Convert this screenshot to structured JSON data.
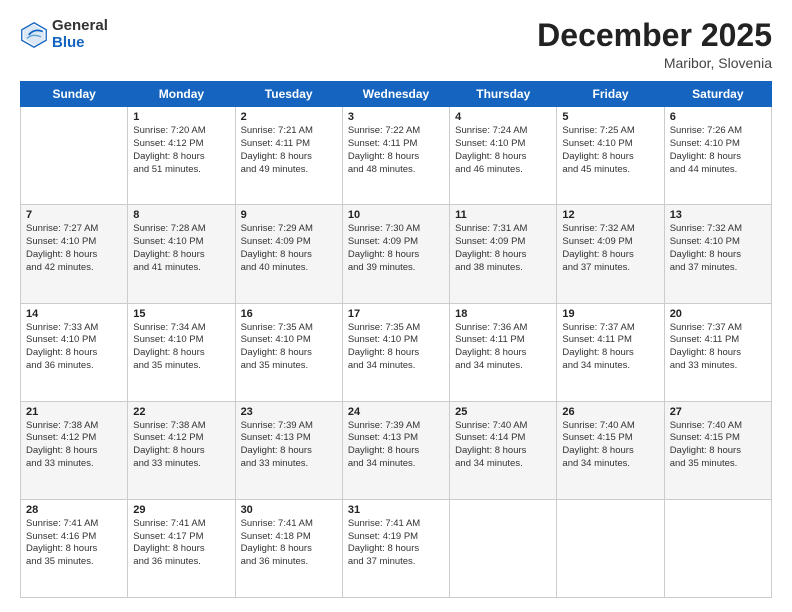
{
  "logo": {
    "general": "General",
    "blue": "Blue"
  },
  "header": {
    "month": "December 2025",
    "location": "Maribor, Slovenia"
  },
  "days_of_week": [
    "Sunday",
    "Monday",
    "Tuesday",
    "Wednesday",
    "Thursday",
    "Friday",
    "Saturday"
  ],
  "weeks": [
    [
      {
        "day": "",
        "info": ""
      },
      {
        "day": "1",
        "info": "Sunrise: 7:20 AM\nSunset: 4:12 PM\nDaylight: 8 hours\nand 51 minutes."
      },
      {
        "day": "2",
        "info": "Sunrise: 7:21 AM\nSunset: 4:11 PM\nDaylight: 8 hours\nand 49 minutes."
      },
      {
        "day": "3",
        "info": "Sunrise: 7:22 AM\nSunset: 4:11 PM\nDaylight: 8 hours\nand 48 minutes."
      },
      {
        "day": "4",
        "info": "Sunrise: 7:24 AM\nSunset: 4:10 PM\nDaylight: 8 hours\nand 46 minutes."
      },
      {
        "day": "5",
        "info": "Sunrise: 7:25 AM\nSunset: 4:10 PM\nDaylight: 8 hours\nand 45 minutes."
      },
      {
        "day": "6",
        "info": "Sunrise: 7:26 AM\nSunset: 4:10 PM\nDaylight: 8 hours\nand 44 minutes."
      }
    ],
    [
      {
        "day": "7",
        "info": "Sunrise: 7:27 AM\nSunset: 4:10 PM\nDaylight: 8 hours\nand 42 minutes."
      },
      {
        "day": "8",
        "info": "Sunrise: 7:28 AM\nSunset: 4:10 PM\nDaylight: 8 hours\nand 41 minutes."
      },
      {
        "day": "9",
        "info": "Sunrise: 7:29 AM\nSunset: 4:09 PM\nDaylight: 8 hours\nand 40 minutes."
      },
      {
        "day": "10",
        "info": "Sunrise: 7:30 AM\nSunset: 4:09 PM\nDaylight: 8 hours\nand 39 minutes."
      },
      {
        "day": "11",
        "info": "Sunrise: 7:31 AM\nSunset: 4:09 PM\nDaylight: 8 hours\nand 38 minutes."
      },
      {
        "day": "12",
        "info": "Sunrise: 7:32 AM\nSunset: 4:09 PM\nDaylight: 8 hours\nand 37 minutes."
      },
      {
        "day": "13",
        "info": "Sunrise: 7:32 AM\nSunset: 4:10 PM\nDaylight: 8 hours\nand 37 minutes."
      }
    ],
    [
      {
        "day": "14",
        "info": "Sunrise: 7:33 AM\nSunset: 4:10 PM\nDaylight: 8 hours\nand 36 minutes."
      },
      {
        "day": "15",
        "info": "Sunrise: 7:34 AM\nSunset: 4:10 PM\nDaylight: 8 hours\nand 35 minutes."
      },
      {
        "day": "16",
        "info": "Sunrise: 7:35 AM\nSunset: 4:10 PM\nDaylight: 8 hours\nand 35 minutes."
      },
      {
        "day": "17",
        "info": "Sunrise: 7:35 AM\nSunset: 4:10 PM\nDaylight: 8 hours\nand 34 minutes."
      },
      {
        "day": "18",
        "info": "Sunrise: 7:36 AM\nSunset: 4:11 PM\nDaylight: 8 hours\nand 34 minutes."
      },
      {
        "day": "19",
        "info": "Sunrise: 7:37 AM\nSunset: 4:11 PM\nDaylight: 8 hours\nand 34 minutes."
      },
      {
        "day": "20",
        "info": "Sunrise: 7:37 AM\nSunset: 4:11 PM\nDaylight: 8 hours\nand 33 minutes."
      }
    ],
    [
      {
        "day": "21",
        "info": "Sunrise: 7:38 AM\nSunset: 4:12 PM\nDaylight: 8 hours\nand 33 minutes."
      },
      {
        "day": "22",
        "info": "Sunrise: 7:38 AM\nSunset: 4:12 PM\nDaylight: 8 hours\nand 33 minutes."
      },
      {
        "day": "23",
        "info": "Sunrise: 7:39 AM\nSunset: 4:13 PM\nDaylight: 8 hours\nand 33 minutes."
      },
      {
        "day": "24",
        "info": "Sunrise: 7:39 AM\nSunset: 4:13 PM\nDaylight: 8 hours\nand 34 minutes."
      },
      {
        "day": "25",
        "info": "Sunrise: 7:40 AM\nSunset: 4:14 PM\nDaylight: 8 hours\nand 34 minutes."
      },
      {
        "day": "26",
        "info": "Sunrise: 7:40 AM\nSunset: 4:15 PM\nDaylight: 8 hours\nand 34 minutes."
      },
      {
        "day": "27",
        "info": "Sunrise: 7:40 AM\nSunset: 4:15 PM\nDaylight: 8 hours\nand 35 minutes."
      }
    ],
    [
      {
        "day": "28",
        "info": "Sunrise: 7:41 AM\nSunset: 4:16 PM\nDaylight: 8 hours\nand 35 minutes."
      },
      {
        "day": "29",
        "info": "Sunrise: 7:41 AM\nSunset: 4:17 PM\nDaylight: 8 hours\nand 36 minutes."
      },
      {
        "day": "30",
        "info": "Sunrise: 7:41 AM\nSunset: 4:18 PM\nDaylight: 8 hours\nand 36 minutes."
      },
      {
        "day": "31",
        "info": "Sunrise: 7:41 AM\nSunset: 4:19 PM\nDaylight: 8 hours\nand 37 minutes."
      },
      {
        "day": "",
        "info": ""
      },
      {
        "day": "",
        "info": ""
      },
      {
        "day": "",
        "info": ""
      }
    ]
  ]
}
